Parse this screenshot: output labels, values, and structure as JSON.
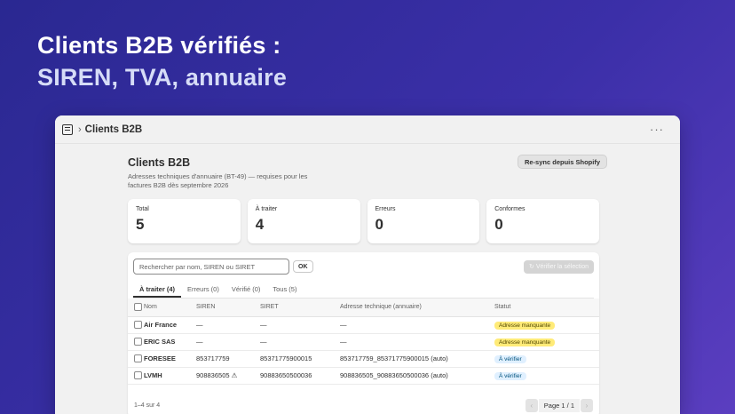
{
  "hero": {
    "line1": "Clients B2B vérifiés :",
    "line2": "SIREN, TVA, annuaire"
  },
  "window": {
    "title": "Clients B2B",
    "more": "···"
  },
  "page": {
    "title": "Clients B2B",
    "subtitle": "Adresses techniques d'annuaire (BT-49) — requises pour les factures B2B dès septembre 2026",
    "resync_label": "Re-sync depuis Shopify"
  },
  "stats": [
    {
      "label": "Total",
      "value": "5"
    },
    {
      "label": "À traiter",
      "value": "4"
    },
    {
      "label": "Erreurs",
      "value": "0"
    },
    {
      "label": "Conformes",
      "value": "0"
    }
  ],
  "toolbar": {
    "search_placeholder": "Rechercher par nom, SIREN ou SIRET",
    "ok_label": "OK",
    "verify_label": "↻ Vérifier la sélection"
  },
  "tabs": [
    {
      "label": "À traiter (4)",
      "active": true
    },
    {
      "label": "Erreurs (0)",
      "active": false
    },
    {
      "label": "Vérifié (0)",
      "active": false
    },
    {
      "label": "Tous (5)",
      "active": false
    }
  ],
  "table": {
    "columns": [
      "Nom",
      "SIREN",
      "SIRET",
      "Adresse technique (annuaire)",
      "Statut"
    ],
    "rows": [
      {
        "nom": "Air France",
        "siren": "—",
        "siret": "—",
        "adresse": "—",
        "statut": "Adresse manquante",
        "statut_kind": "warn"
      },
      {
        "nom": "ERIC SAS",
        "siren": "—",
        "siret": "—",
        "adresse": "—",
        "statut": "Adresse manquante",
        "statut_kind": "warn"
      },
      {
        "nom": "FORESEE",
        "siren": "853717759",
        "siret": "85371775900015",
        "adresse": "853717759_85371775900015 (auto)",
        "statut": "À vérifier",
        "statut_kind": "info"
      },
      {
        "nom": "LVMH",
        "siren": "908836505 ⚠",
        "siret": "90883650500036",
        "adresse": "908836505_90883650500036 (auto)",
        "statut": "À vérifier",
        "statut_kind": "info"
      }
    ]
  },
  "footer": {
    "count": "1–4 sur 4",
    "page_label": "Page 1 / 1",
    "prev": "‹",
    "next": "›"
  },
  "colors": {
    "background_start": "#2a2891",
    "background_end": "#5b3ec0",
    "badge_warn": "#ffeb78",
    "badge_info": "#e0f0ff"
  }
}
